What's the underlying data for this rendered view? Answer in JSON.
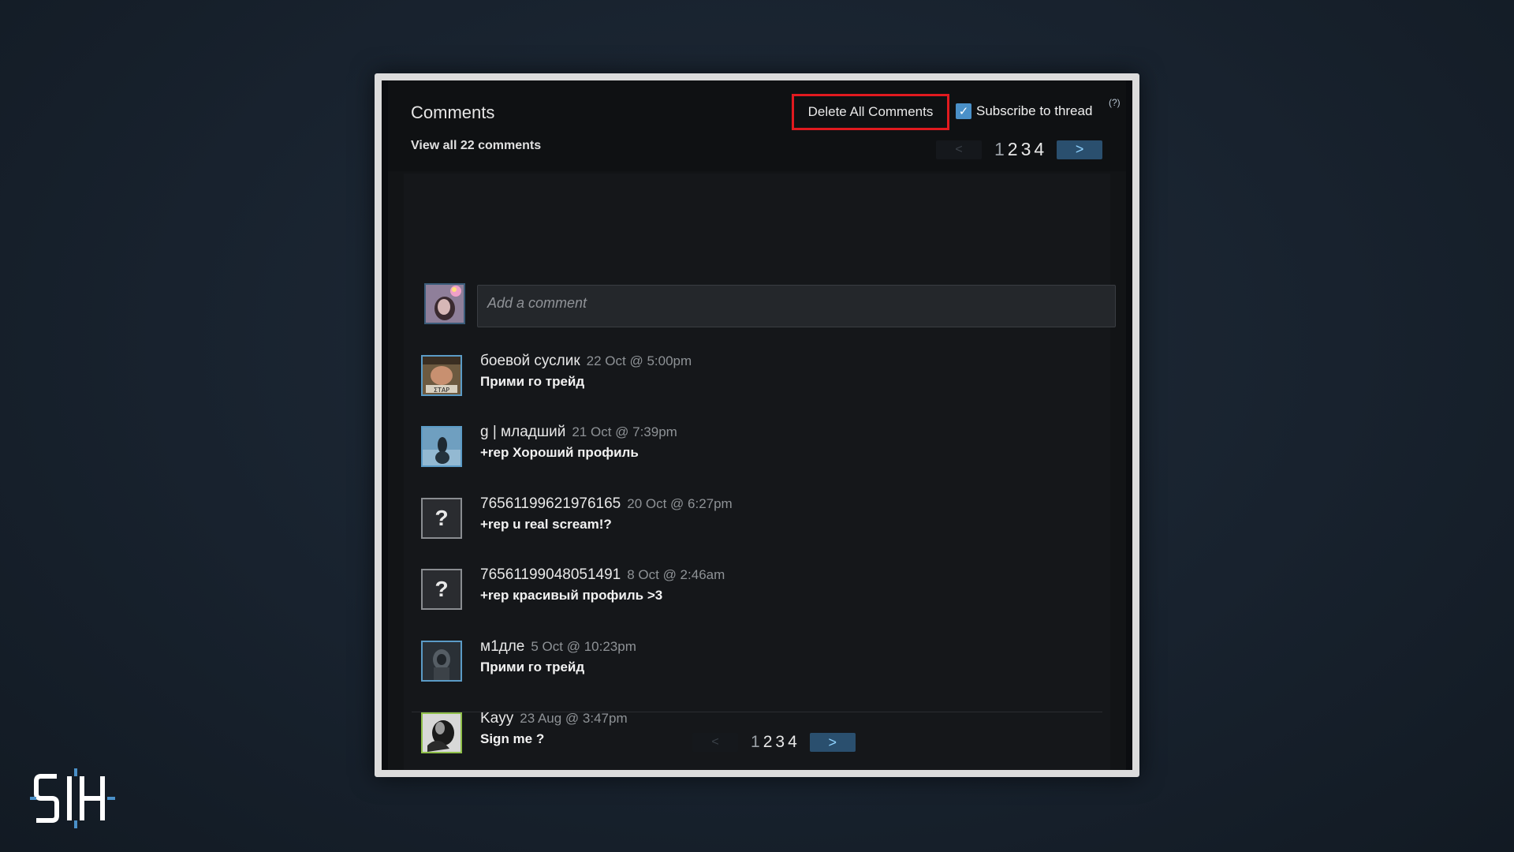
{
  "comments_panel": {
    "title": "Comments",
    "view_all": "View all 22 comments",
    "delete_all": "Delete All Comments",
    "subscribe_label": "Subscribe to thread",
    "subscribe_checked": true,
    "help": "(?)",
    "add_comment_placeholder": "Add a comment",
    "pager": {
      "prev": "<",
      "next": ">",
      "pages": [
        "1",
        "2",
        "3",
        "4"
      ],
      "current_page": "1"
    },
    "comments": [
      {
        "author": "боевой суслик",
        "time": "22 Oct @ 5:00pm",
        "text": "Прими го трейд",
        "avatar": "custom-image",
        "frame_color": "#5b9bc6"
      },
      {
        "author": "g | младший",
        "time": "21 Oct @ 7:39pm",
        "text": "+rep Хороший профиль",
        "avatar": "custom-image",
        "frame_color": "#5b9bc6"
      },
      {
        "author": "76561199621976165",
        "time": "20 Oct @ 6:27pm",
        "text": "+rep u real scream!?",
        "avatar": "question-mark",
        "frame_color": "#8a8d91"
      },
      {
        "author": "76561199048051491",
        "time": "8 Oct @ 2:46am",
        "text": "+rep красивый профиль >3",
        "avatar": "question-mark",
        "frame_color": "#8a8d91"
      },
      {
        "author": "м1дле",
        "time": "5 Oct @ 10:23pm",
        "text": "Прими го трейд",
        "avatar": "custom-image",
        "frame_color": "#5b9bc6"
      },
      {
        "author": "Kayy",
        "time": "23 Aug @ 3:47pm",
        "text": "Sign me ?",
        "avatar": "custom-image",
        "frame_color": "#8fbf4a"
      }
    ]
  },
  "colors": {
    "highlight_border": "#e11a1f",
    "next_button": "#2a4f6e",
    "checkbox": "#4a90c8"
  },
  "icons": [
    "checkmark-icon",
    "question-mark-icon",
    "chevron-left-icon",
    "chevron-right-icon",
    "sih-logo"
  ]
}
